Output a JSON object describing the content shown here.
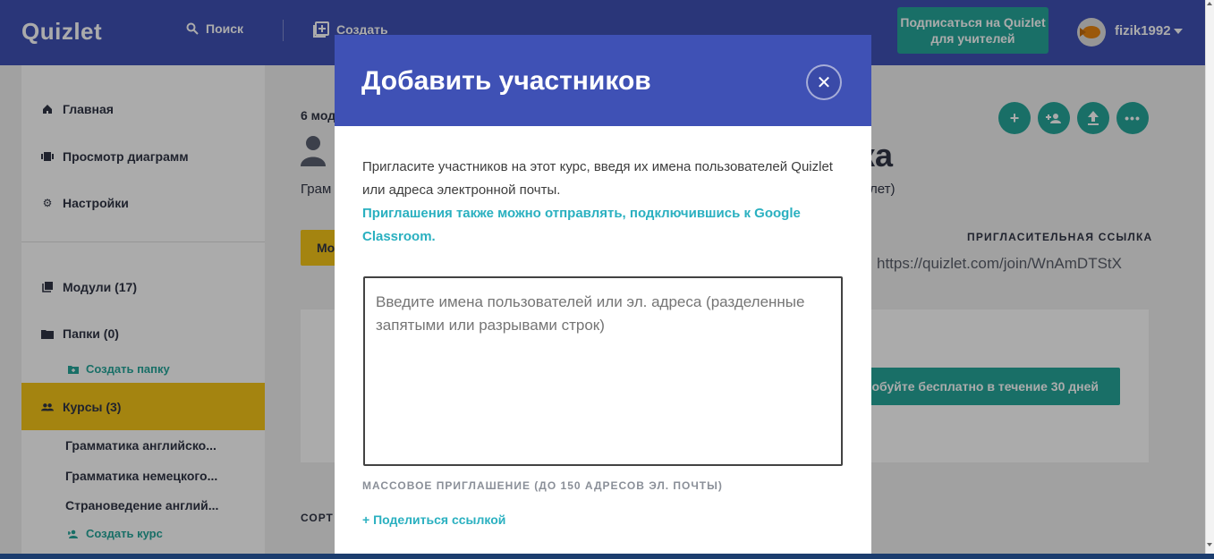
{
  "topbar": {
    "logo": "Quizlet",
    "search_label": "Поиск",
    "create_label": "Создать",
    "teacher_cta": "Подписаться на Quizlet для учителей",
    "username": "fizik1992"
  },
  "sidebar": {
    "items": [
      {
        "label": "Главная",
        "icon": "home-icon"
      },
      {
        "label": "Просмотр диаграмм",
        "icon": "diagram-icon"
      },
      {
        "label": "Настройки",
        "icon": "gear-icon"
      }
    ],
    "modules": "Модули (17)",
    "folders": "Папки (0)",
    "create_folder": "Создать папку",
    "courses": "Курсы (3)",
    "course_list": [
      "Грамматика английско...",
      "Грамматика немецкого...",
      "Страноведение англий..."
    ],
    "create_course": "Создать курс"
  },
  "main": {
    "modules_count": "6 мод",
    "title_tail": "ка",
    "subtitle_start": "Грам",
    "subtitle_tail": "лет)",
    "button_start": "Мо",
    "invite_link_label": "ПРИГЛАСИТЕЛЬНАЯ ССЫЛКА",
    "invite_link": "https://quizlet.com/join/WnAmDTStX",
    "try_button": "обуйте бесплатно в течение 30 дней",
    "sort_label": "СОРТ"
  },
  "modal": {
    "title": "Добавить участников",
    "description": "Пригласите участников на этот курс, введя их имена пользователей Quizlet или адреса электронной почты.",
    "google_classroom": "Приглашения также можно отправлять, подключившись к Google Classroom.",
    "textarea_placeholder": "Введите имена пользователей или эл. адреса (разделенные запятыми или разрывами строк)",
    "mass_invite_label": "МАССОВОЕ ПРИГЛАШЕНИЕ (ДО 150 АДРЕСОВ ЭЛ. ПОЧТЫ)",
    "share_link": "+ Поделиться ссылкой"
  },
  "colors": {
    "brand_indigo": "#3f51b5",
    "accent_teal": "#26a69a",
    "link_cyan": "#2ab0c0",
    "active_yellow": "#f5c518"
  }
}
